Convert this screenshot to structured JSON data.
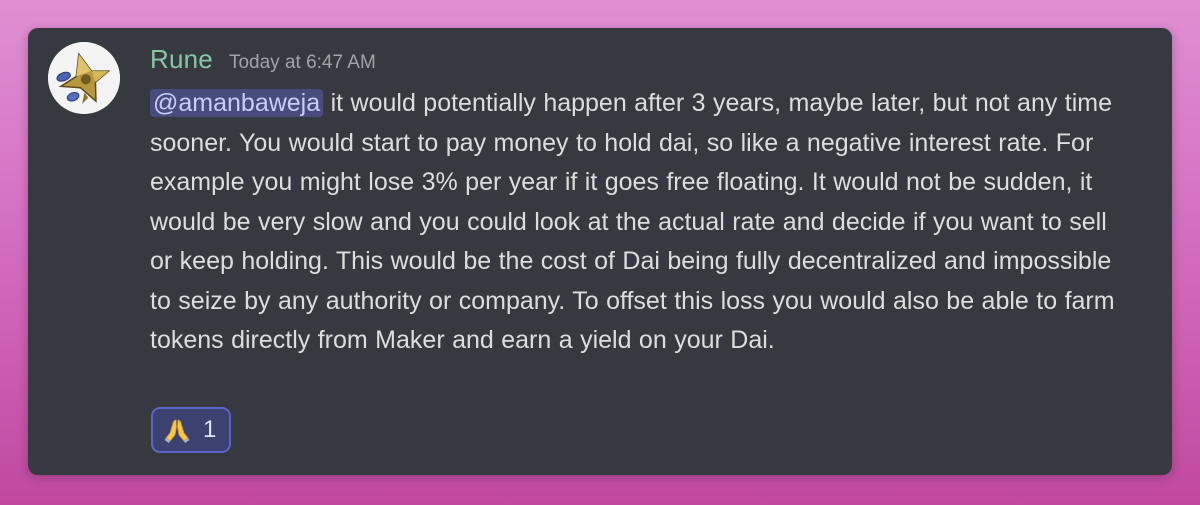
{
  "message": {
    "author": "Rune",
    "timestamp": "Today at 6:47 AM",
    "mention": "@amanbaweja",
    "body": " it would potentially happen after 3 years, maybe later, but not any time sooner. You would start to pay money to hold dai, so like a negative interest rate. For example you might lose 3% per year if it goes free floating. It would not be sudden, it would be very slow and you could look at the actual rate and decide if you want to sell or keep holding. This would be the cost of Dai being fully decentralized and impossible to seize by any authority or company. To offset this loss you would also be able to farm tokens directly from Maker and earn a yield on your Dai."
  },
  "reaction": {
    "emoji": "folded-hands-icon",
    "count": "1"
  },
  "colors": {
    "username": "#84c7a7",
    "mention_bg": "#474c7d",
    "card_bg": "#36393f",
    "reaction_border": "#5b64c9"
  }
}
